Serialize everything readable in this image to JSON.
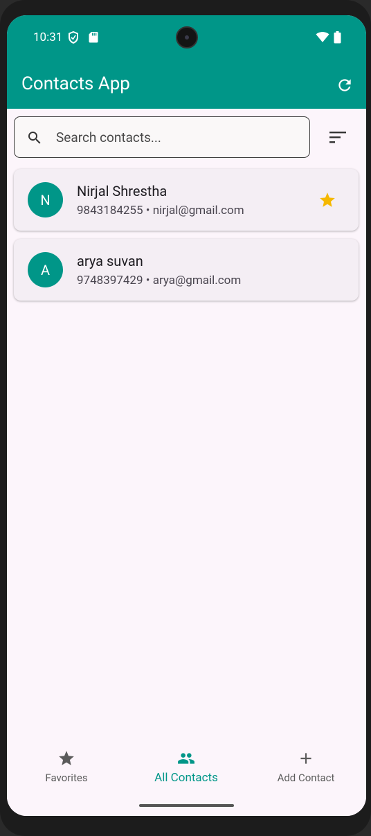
{
  "status_bar": {
    "time": "10:31"
  },
  "app_bar": {
    "title": "Contacts App",
    "refresh_icon": "refresh-icon"
  },
  "search": {
    "placeholder": "Search contacts...",
    "value": ""
  },
  "contacts": [
    {
      "initial": "N",
      "name": "Nirjal Shrestha",
      "details": "9843184255 • nirjal@gmail.com",
      "favorite": true
    },
    {
      "initial": "A",
      "name": "arya suvan",
      "details": "9748397429 • arya@gmail.com",
      "favorite": false
    }
  ],
  "bottom_nav": {
    "items": [
      {
        "label": "Favorites",
        "icon": "star-icon",
        "active": false
      },
      {
        "label": "All Contacts",
        "icon": "people-icon",
        "active": true
      },
      {
        "label": "Add Contact",
        "icon": "plus-icon",
        "active": false
      }
    ]
  },
  "colors": {
    "primary": "#009688",
    "star": "#f5b800",
    "background": "#fcf5fb",
    "card": "#f4eef4"
  }
}
